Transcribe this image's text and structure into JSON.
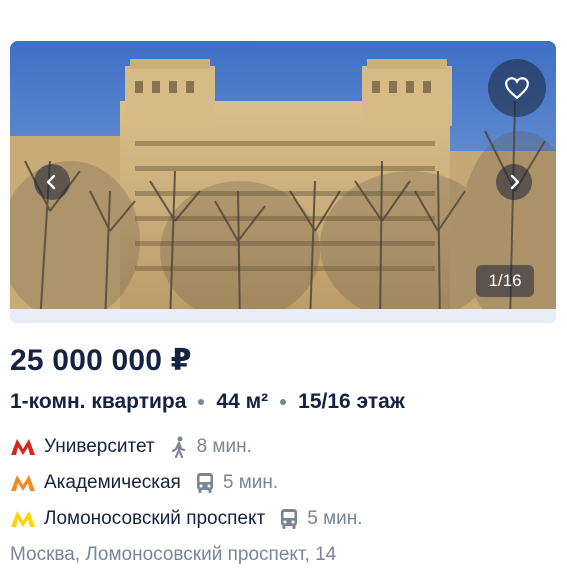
{
  "photo": {
    "counter": "1/16",
    "favorite_icon": "heart-icon",
    "prev_icon": "chevron-left-icon",
    "next_icon": "chevron-right-icon"
  },
  "listing": {
    "price": "25 000 000 ₽",
    "rooms": "1-комн. квартира",
    "area": "44 м²",
    "floor": "15/16 этаж",
    "address": "Москва, Ломоносовский проспект, 14"
  },
  "metro": [
    {
      "station": "Университет",
      "time": "8 мин.",
      "line_color": "#d6261b",
      "travel_icon": "walk-icon"
    },
    {
      "station": "Академическая",
      "time": "5 мин.",
      "line_color": "#f08a24",
      "travel_icon": "bus-icon"
    },
    {
      "station": "Ломоносовский проспект",
      "time": "5 мин.",
      "line_color": "#ffd400",
      "travel_icon": "bus-icon"
    }
  ],
  "colors": {
    "price_text": "#152242",
    "secondary_text": "#7a8596",
    "overlay": "rgba(25,35,55,0.55)"
  }
}
